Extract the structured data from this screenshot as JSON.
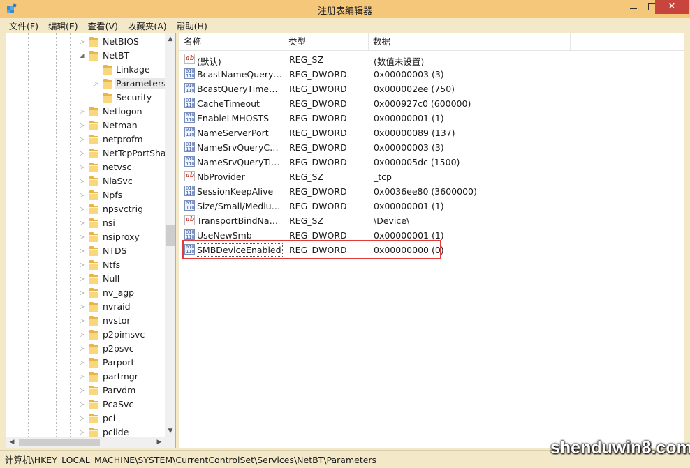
{
  "window": {
    "title": "注册表编辑器",
    "close_glyph": "✕"
  },
  "menu": [
    {
      "label": "文件(F)"
    },
    {
      "label": "编辑(E)"
    },
    {
      "label": "查看(V)"
    },
    {
      "label": "收藏夹(A)"
    },
    {
      "label": "帮助(H)"
    }
  ],
  "tree": {
    "items": [
      {
        "label": "NetBIOS",
        "level": 1,
        "expander": "▷"
      },
      {
        "label": "NetBT",
        "level": 1,
        "expander": "◢"
      },
      {
        "label": "Linkage",
        "level": 2,
        "expander": ""
      },
      {
        "label": "Parameters",
        "level": 2,
        "expander": "▷",
        "selected": true
      },
      {
        "label": "Security",
        "level": 2,
        "expander": ""
      },
      {
        "label": "Netlogon",
        "level": 1,
        "expander": "▷"
      },
      {
        "label": "Netman",
        "level": 1,
        "expander": "▷"
      },
      {
        "label": "netprofm",
        "level": 1,
        "expander": "▷"
      },
      {
        "label": "NetTcpPortSha",
        "level": 1,
        "expander": "▷"
      },
      {
        "label": "netvsc",
        "level": 1,
        "expander": "▷"
      },
      {
        "label": "NlaSvc",
        "level": 1,
        "expander": "▷"
      },
      {
        "label": "Npfs",
        "level": 1,
        "expander": "▷"
      },
      {
        "label": "npsvctrig",
        "level": 1,
        "expander": "▷"
      },
      {
        "label": "nsi",
        "level": 1,
        "expander": "▷"
      },
      {
        "label": "nsiproxy",
        "level": 1,
        "expander": "▷"
      },
      {
        "label": "NTDS",
        "level": 1,
        "expander": "▷"
      },
      {
        "label": "Ntfs",
        "level": 1,
        "expander": "▷"
      },
      {
        "label": "Null",
        "level": 1,
        "expander": "▷"
      },
      {
        "label": "nv_agp",
        "level": 1,
        "expander": "▷"
      },
      {
        "label": "nvraid",
        "level": 1,
        "expander": "▷"
      },
      {
        "label": "nvstor",
        "level": 1,
        "expander": "▷"
      },
      {
        "label": "p2pimsvc",
        "level": 1,
        "expander": "▷"
      },
      {
        "label": "p2psvc",
        "level": 1,
        "expander": "▷"
      },
      {
        "label": "Parport",
        "level": 1,
        "expander": "▷"
      },
      {
        "label": "partmgr",
        "level": 1,
        "expander": "▷"
      },
      {
        "label": "Parvdm",
        "level": 1,
        "expander": "▷"
      },
      {
        "label": "PcaSvc",
        "level": 1,
        "expander": "▷"
      },
      {
        "label": "pci",
        "level": 1,
        "expander": "▷"
      },
      {
        "label": "pciide",
        "level": 1,
        "expander": "▷"
      }
    ],
    "scroll_up": "▲",
    "scroll_down": "▼",
    "scroll_left": "◀",
    "scroll_right": "▶"
  },
  "list": {
    "headers": {
      "name": "名称",
      "type": "类型",
      "data": "数据"
    },
    "rows": [
      {
        "icon": "string-value-icon",
        "glyph": "ab",
        "name": "(默认)",
        "type": "REG_SZ",
        "data": "(数值未设置)"
      },
      {
        "icon": "dword-value-icon",
        "glyph": "010\n110",
        "name": "BcastNameQueryC...",
        "type": "REG_DWORD",
        "data": "0x00000003 (3)"
      },
      {
        "icon": "dword-value-icon",
        "glyph": "010\n110",
        "name": "BcastQueryTimeout",
        "type": "REG_DWORD",
        "data": "0x000002ee (750)"
      },
      {
        "icon": "dword-value-icon",
        "glyph": "010\n110",
        "name": "CacheTimeout",
        "type": "REG_DWORD",
        "data": "0x000927c0 (600000)"
      },
      {
        "icon": "dword-value-icon",
        "glyph": "010\n110",
        "name": "EnableLMHOSTS",
        "type": "REG_DWORD",
        "data": "0x00000001 (1)"
      },
      {
        "icon": "dword-value-icon",
        "glyph": "010\n110",
        "name": "NameServerPort",
        "type": "REG_DWORD",
        "data": "0x00000089 (137)"
      },
      {
        "icon": "dword-value-icon",
        "glyph": "010\n110",
        "name": "NameSrvQueryCount",
        "type": "REG_DWORD",
        "data": "0x00000003 (3)"
      },
      {
        "icon": "dword-value-icon",
        "glyph": "010\n110",
        "name": "NameSrvQueryTim...",
        "type": "REG_DWORD",
        "data": "0x000005dc (1500)"
      },
      {
        "icon": "string-value-icon",
        "glyph": "ab",
        "name": "NbProvider",
        "type": "REG_SZ",
        "data": "_tcp"
      },
      {
        "icon": "dword-value-icon",
        "glyph": "010\n110",
        "name": "SessionKeepAlive",
        "type": "REG_DWORD",
        "data": "0x0036ee80 (3600000)"
      },
      {
        "icon": "dword-value-icon",
        "glyph": "010\n110",
        "name": "Size/Small/Medium...",
        "type": "REG_DWORD",
        "data": "0x00000001 (1)"
      },
      {
        "icon": "string-value-icon",
        "glyph": "ab",
        "name": "TransportBindName",
        "type": "REG_SZ",
        "data": "\\Device\\"
      },
      {
        "icon": "dword-value-icon",
        "glyph": "010\n110",
        "name": "UseNewSmb",
        "type": "REG_DWORD",
        "data": "0x00000001 (1)"
      },
      {
        "icon": "dword-value-icon",
        "glyph": "010\n110",
        "name": "SMBDeviceEnabled",
        "type": "REG_DWORD",
        "data": "0x00000000 (0)",
        "focused": true
      }
    ]
  },
  "status": {
    "path": "计算机\\HKEY_LOCAL_MACHINE\\SYSTEM\\CurrentControlSet\\Services\\NetBT\\Parameters"
  },
  "watermark": {
    "text": "shenduwin8.com"
  },
  "colors": {
    "titlebar": "#f4c77a",
    "close_button": "#c7453d",
    "highlight_border": "#e03b3b",
    "folder": "#f9d77c"
  }
}
